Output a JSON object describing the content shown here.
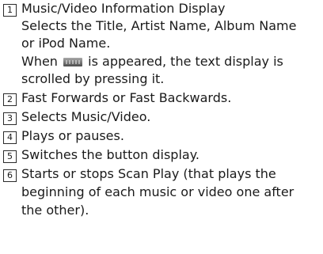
{
  "items": [
    {
      "number": "1",
      "title": "Music/Video Information Display",
      "desc1": "Selects the Title, Artist Name, Album Name",
      "desc2": "or iPod Name.",
      "desc3_before": "When",
      "desc3_icon": "scroll-icon",
      "desc3_after": "is appeared, the text display is",
      "desc4": "scrolled by pressing it."
    },
    {
      "number": "2",
      "text": "Fast Forwards or Fast Backwards."
    },
    {
      "number": "3",
      "text": "Selects Music/Video."
    },
    {
      "number": "4",
      "text": "Plays or pauses."
    },
    {
      "number": "5",
      "text": "Switches the button display."
    },
    {
      "number": "6",
      "line1": "Starts or stops Scan Play (that plays the",
      "line2": "beginning of each music or video one after",
      "line3": "the other)."
    }
  ]
}
